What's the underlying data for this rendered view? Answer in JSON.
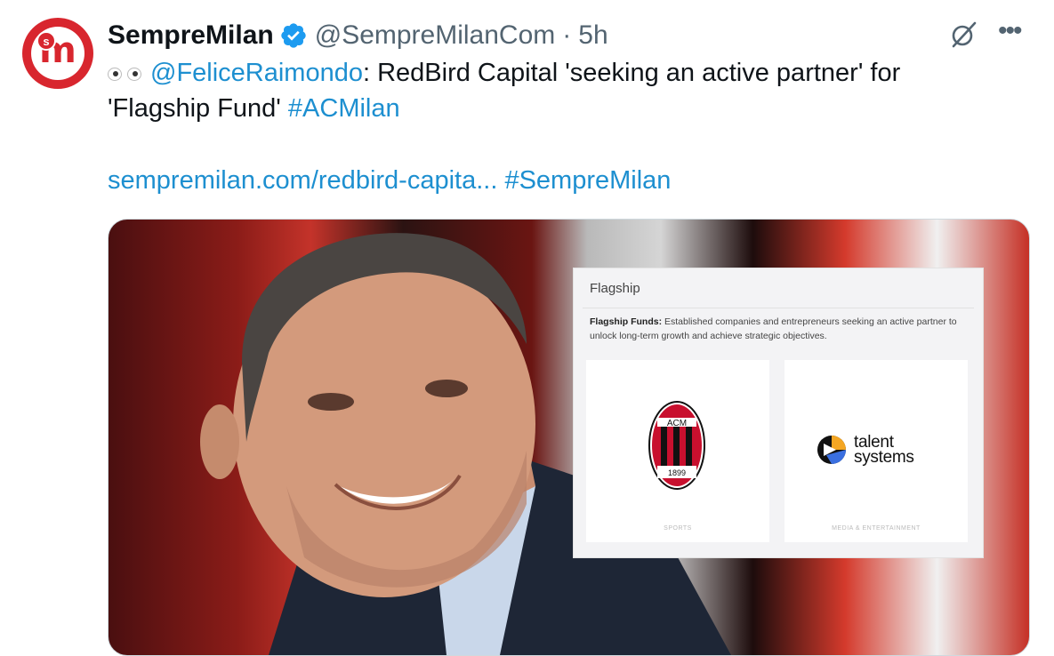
{
  "tweet": {
    "display_name": "SempreMilan",
    "handle": "@SempreMilanCom",
    "separator": "·",
    "time": "5h",
    "mention": "@FeliceRaimondo",
    "text_part1": ": RedBird Capital 'seeking an active partner' for 'Flagship Fund' ",
    "hashtag1": "#ACMilan",
    "url": "sempremilan.com/redbird-capita...",
    "hashtag2": "#SempreMilan"
  },
  "avatar": {
    "letter": "m",
    "small_letter": "s"
  },
  "icons": {
    "verified": "verified-badge-icon",
    "grok": "grok-icon",
    "more": "more-options-icon"
  },
  "card": {
    "title": "Flagship",
    "desc_bold": "Flagship Funds:",
    "desc_text": " Established companies and entrepreneurs seeking an active partner to unlock long-term growth and achieve strategic objectives.",
    "tiles": [
      {
        "logo_top": "ACM",
        "logo_year": "1899",
        "caption": "SPORTS"
      },
      {
        "logo_line1": "talent",
        "logo_line2": "systems",
        "caption": "MEDIA & ENTERTAINMENT"
      }
    ]
  },
  "colors": {
    "link": "#1d8fd0",
    "verified": "#1d9bf0",
    "milan_red": "#d8262e"
  }
}
